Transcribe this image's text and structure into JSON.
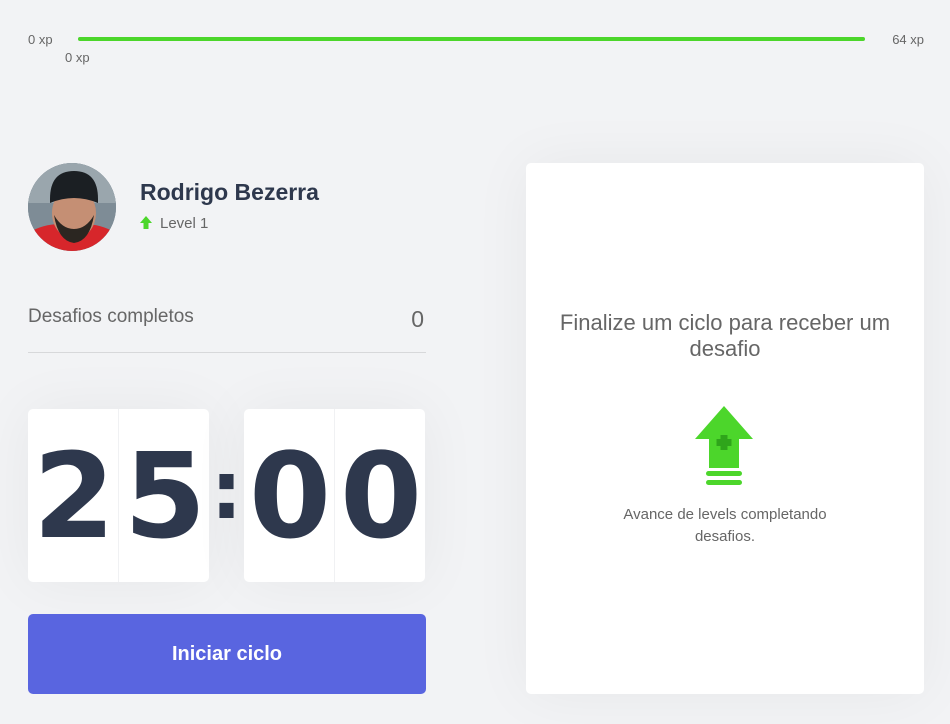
{
  "xp_bar": {
    "min_label": "0 xp",
    "max_label": "64 xp",
    "current_label": "0 xp",
    "progress_fraction": 1.0,
    "color": "#4cd62b"
  },
  "profile": {
    "name": "Rodrigo Bezerra",
    "level_label": "Level 1",
    "level_icon": "level-up-arrow-icon"
  },
  "completed": {
    "label": "Desafios completos",
    "value": "0"
  },
  "countdown": {
    "minute_left": "2",
    "minute_right": "5",
    "separator": ":",
    "second_left": "0",
    "second_right": "0"
  },
  "start_button": {
    "label": "Iniciar ciclo",
    "color": "#5965e0"
  },
  "challenge_box": {
    "title": "Finalize um ciclo para receber um desafio",
    "icon": "level-up-icon",
    "text": "Avance de levels completando desafios."
  }
}
